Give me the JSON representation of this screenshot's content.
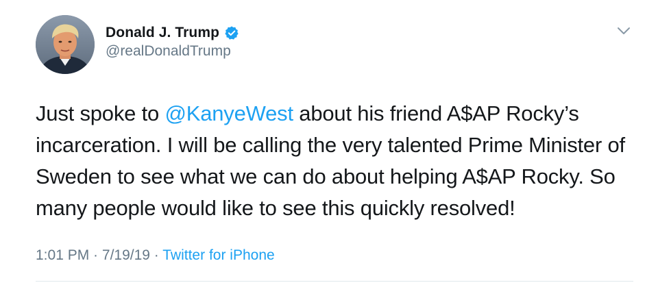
{
  "user": {
    "display_name": "Donald J. Trump",
    "handle": "@realDonaldTrump",
    "verified": true,
    "avatar_icon": "profile-photo"
  },
  "tweet": {
    "text_before_mention": "Just spoke to ",
    "mention": "@KanyeWest",
    "text_after_mention": " about his friend A$AP Rocky’s incarceration. I will be calling the very talented Prime Minister of Sweden to see what we can do about helping A$AP Rocky. So many people would like to see this quickly resolved!"
  },
  "meta": {
    "time": "1:01 PM",
    "separator1": " · ",
    "date": "7/19/19",
    "separator2": " · ",
    "source": "Twitter for iPhone"
  },
  "icons": {
    "verified": "verified-badge-icon",
    "menu": "chevron-down-icon"
  },
  "colors": {
    "accent": "#1da1f2",
    "text": "#14171a",
    "secondary": "#657786",
    "divider": "#e1e8ed"
  }
}
